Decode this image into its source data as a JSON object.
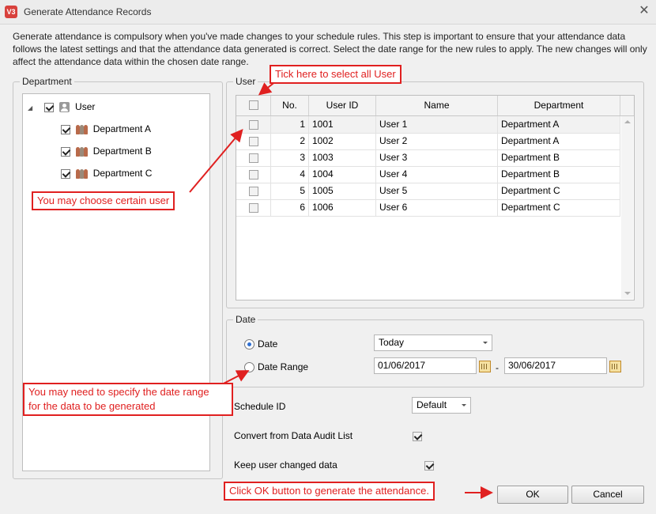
{
  "window": {
    "title": "Generate Attendance Records",
    "app_icon": "V3"
  },
  "description": "Generate attendance is compulsory when you've made changes to your schedule rules. This step is important to ensure that your attendance data follows the latest settings and that the attendance data generated is correct. Select the date range for the new rules to apply. The new changes will only affect the attendance data within the chosen date range.",
  "department": {
    "legend": "Department",
    "root": {
      "label": "User",
      "checked": true
    },
    "children": [
      {
        "label": "Department A",
        "checked": true
      },
      {
        "label": "Department B",
        "checked": true
      },
      {
        "label": "Department C",
        "checked": true
      }
    ]
  },
  "user": {
    "legend": "User",
    "columns": [
      "No.",
      "User ID",
      "Name",
      "Department"
    ],
    "rows": [
      {
        "no": "1",
        "id": "1001",
        "name": "User 1",
        "dept": "Department A"
      },
      {
        "no": "2",
        "id": "1002",
        "name": "User 2",
        "dept": "Department A"
      },
      {
        "no": "3",
        "id": "1003",
        "name": "User 3",
        "dept": "Department B"
      },
      {
        "no": "4",
        "id": "1004",
        "name": "User 4",
        "dept": "Department B"
      },
      {
        "no": "5",
        "id": "1005",
        "name": "User 5",
        "dept": "Department C"
      },
      {
        "no": "6",
        "id": "1006",
        "name": "User 6",
        "dept": "Department C"
      }
    ]
  },
  "date": {
    "legend": "Date",
    "option_date": "Date",
    "option_range": "Date Range",
    "selected": "Date",
    "date_value": "Today",
    "range_from": "01/06/2017",
    "range_sep": "-",
    "range_to": "30/06/2017"
  },
  "options": {
    "schedule_label": "Schedule ID",
    "schedule_value": "Default",
    "convert_label": "Convert from Data Audit List",
    "convert_checked": true,
    "keep_label": "Keep user changed data",
    "keep_checked": true
  },
  "buttons": {
    "ok": "OK",
    "cancel": "Cancel"
  },
  "annotations": {
    "select_all": "Tick here to select all User",
    "choose_user": "You may choose certain user",
    "date_range_1": "You may need to specify the date range",
    "date_range_2": "for the data to be generated",
    "ok_note": "Click OK button to generate the attendance."
  },
  "colors": {
    "annotation": "#e02020",
    "radio_selected": "#2f6fd1"
  }
}
